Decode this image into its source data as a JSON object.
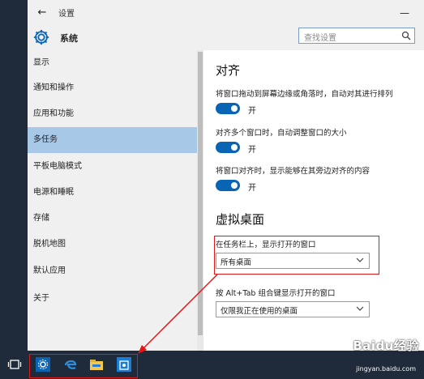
{
  "window": {
    "title": "设置",
    "back_glyph": "←",
    "minimize_glyph": "—"
  },
  "header": {
    "title": "系统",
    "icon": "gear-icon"
  },
  "search": {
    "placeholder": "查找设置",
    "icon": "search-icon"
  },
  "sidebar": {
    "items": [
      {
        "label": "显示",
        "active": false
      },
      {
        "label": "通知和操作",
        "active": false
      },
      {
        "label": "应用和功能",
        "active": false
      },
      {
        "label": "多任务",
        "active": true
      },
      {
        "label": "平板电脑模式",
        "active": false
      },
      {
        "label": "电源和睡眠",
        "active": false
      },
      {
        "label": "存储",
        "active": false
      },
      {
        "label": "脱机地图",
        "active": false
      },
      {
        "label": "默认应用",
        "active": false
      },
      {
        "label": "关于",
        "active": false
      }
    ]
  },
  "snap": {
    "heading": "对齐",
    "options": [
      {
        "desc": "将窗口拖动到屏幕边缘或角落时，自动对其进行排列",
        "state": "开"
      },
      {
        "desc": "对齐多个窗口时，自动调整窗口的大小",
        "state": "开"
      },
      {
        "desc": "将窗口对齐时，显示能够在其旁边对齐的内容",
        "state": "开"
      }
    ]
  },
  "virtual_desktops": {
    "heading": "虚拟桌面",
    "taskbar_label": "在任务栏上，显示打开的窗口",
    "taskbar_value": "所有桌面",
    "alttab_label": "按 Alt+Tab 组合键显示打开的窗口",
    "alttab_value": "仅限我正在使用的桌面"
  },
  "taskbar": {
    "icons": [
      "task-view-icon",
      "settings-icon",
      "edge-icon",
      "file-explorer-icon",
      "store-icon"
    ]
  },
  "watermark": {
    "brand": "Baidu经验",
    "url": "jingyan.baidu.com"
  },
  "colors": {
    "accent": "#0a64b4",
    "selected": "#a8c8e8",
    "annotation": "#e01818",
    "taskbar": "#1f2a3a"
  }
}
